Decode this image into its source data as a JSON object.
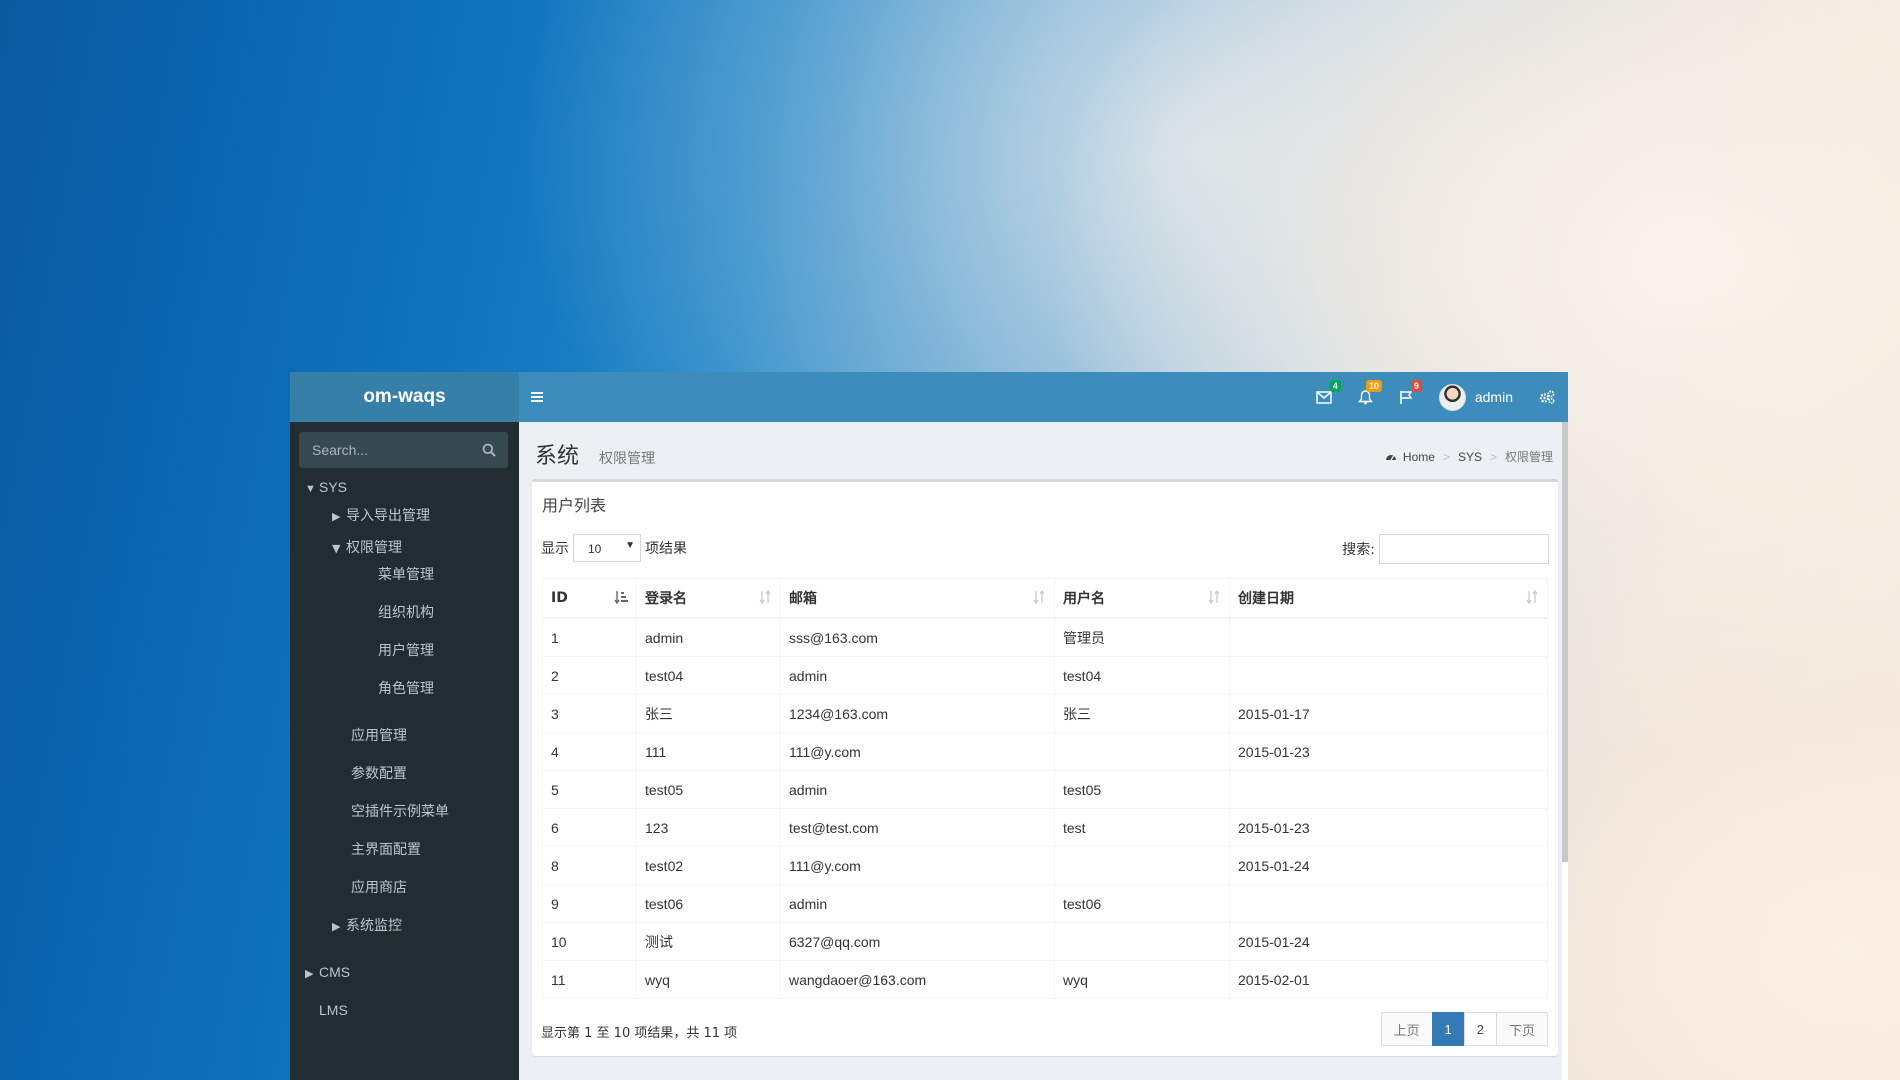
{
  "app": {
    "brand": "om-waqs"
  },
  "topbar": {
    "toggle_icon": "hamburger-icon",
    "mail_badge": "4",
    "bell_badge": "10",
    "flag_badge": "9",
    "user_name": "admin",
    "colors": {
      "header": "#3c8dbc",
      "brand": "#367fa9",
      "badge_green": "#00a65a",
      "badge_yellow": "#f39c12",
      "badge_red": "#dd4b39"
    }
  },
  "sidebar": {
    "search_placeholder": "Search...",
    "items": [
      {
        "label": "SYS",
        "arrow": "▼"
      },
      {
        "label": "导入导出管理",
        "arrow": "▶"
      },
      {
        "label": "权限管理",
        "arrow": "▼"
      },
      {
        "label": "菜单管理"
      },
      {
        "label": "组织机构"
      },
      {
        "label": "用户管理"
      },
      {
        "label": "角色管理"
      },
      {
        "label": "应用管理"
      },
      {
        "label": "参数配置"
      },
      {
        "label": "空插件示例菜单"
      },
      {
        "label": "主界面配置"
      },
      {
        "label": "应用商店"
      },
      {
        "label": "系统监控",
        "arrow": "▶"
      },
      {
        "label": "CMS",
        "arrow": "▶"
      },
      {
        "label": "LMS"
      }
    ]
  },
  "page": {
    "title": "系统",
    "subtitle": "权限管理",
    "breadcrumb": [
      "Home",
      "SYS",
      "权限管理"
    ]
  },
  "box": {
    "title": "用户列表",
    "length_prefix": "显示",
    "length_value": "10",
    "length_suffix": "项结果",
    "search_label": "搜索:",
    "columns": [
      "ID",
      "登录名",
      "邮箱",
      "用户名",
      "创建日期"
    ],
    "rows": [
      [
        "1",
        "admin",
        "sss@163.com",
        "管理员",
        ""
      ],
      [
        "2",
        "test04",
        "admin",
        "test04",
        ""
      ],
      [
        "3",
        "张三",
        "1234@163.com",
        "张三",
        "2015-01-17"
      ],
      [
        "4",
        "111",
        "111@y.com",
        "",
        "2015-01-23"
      ],
      [
        "5",
        "test05",
        "admin",
        "test05",
        ""
      ],
      [
        "6",
        "123",
        "test@test.com",
        "test",
        "2015-01-23"
      ],
      [
        "8",
        "test02",
        "111@y.com",
        "",
        "2015-01-24"
      ],
      [
        "9",
        "test06",
        "admin",
        "test06",
        ""
      ],
      [
        "10",
        "测试",
        "6327@qq.com",
        "",
        "2015-01-24"
      ],
      [
        "11",
        "wyq",
        "wangdaoer@163.com",
        "wyq",
        "2015-02-01"
      ]
    ],
    "info": "显示第 1 至 10 项结果，共 11 项",
    "pager": {
      "prev": "上页",
      "pages": [
        "1",
        "2"
      ],
      "current": "1",
      "next": "下页"
    }
  }
}
